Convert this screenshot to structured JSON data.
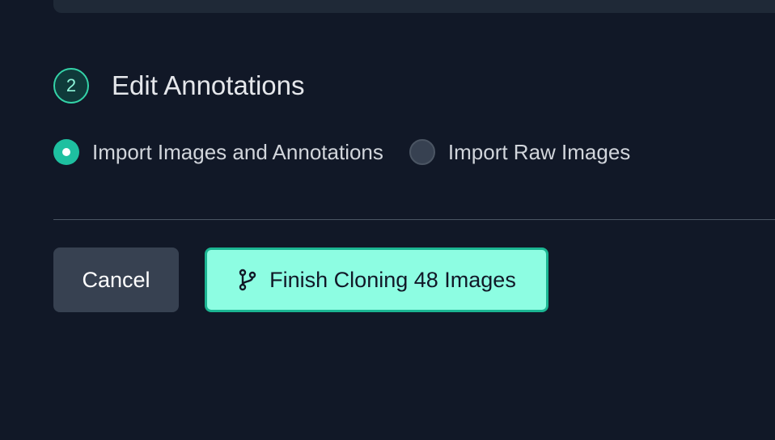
{
  "step": {
    "number": "2",
    "title": "Edit Annotations"
  },
  "import_options": [
    {
      "label": "Import Images and Annotations",
      "selected": true
    },
    {
      "label": "Import Raw Images",
      "selected": false
    }
  ],
  "actions": {
    "cancel_label": "Cancel",
    "finish_label": "Finish Cloning 48 Images",
    "finish_icon": "git-branch-icon"
  },
  "colors": {
    "background": "#111827",
    "accent": "#1ec0a0",
    "finish_button": "#8dfde2",
    "cancel_button": "#374151"
  }
}
